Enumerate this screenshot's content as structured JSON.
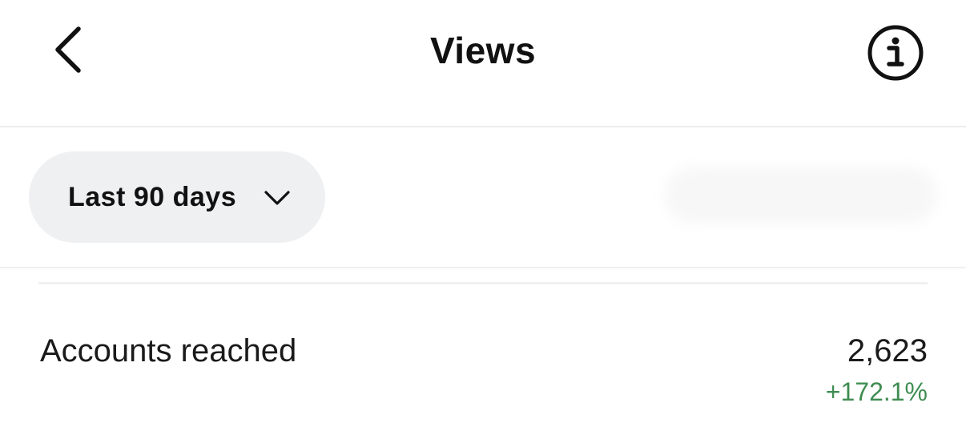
{
  "header": {
    "title": "Views",
    "back_icon": "chevron-left-icon",
    "info_icon": "info-circle-icon"
  },
  "filter": {
    "date_range": "Last 90 days",
    "dropdown_icon": "chevron-down-icon"
  },
  "metrics": [
    {
      "label": "Accounts reached",
      "value": "2,623",
      "change": "+172.1%",
      "change_color": "#3f8d52"
    }
  ]
}
